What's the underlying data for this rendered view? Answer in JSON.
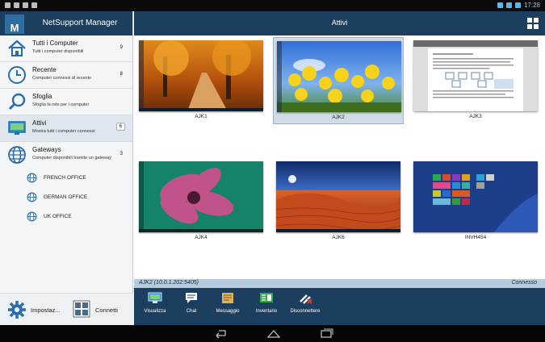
{
  "statusbar": {
    "clock": "17:28"
  },
  "sidebar": {
    "app_title": "NetSupport Manager",
    "logo_letter": "M",
    "items": [
      {
        "label": "Tutti i Computer",
        "sub": "Tutti i computer disponibili",
        "count": "9",
        "icon": "home-icon"
      },
      {
        "label": "Recente",
        "sub": "Computer connessi di recente",
        "count": "8",
        "icon": "clock-icon"
      },
      {
        "label": "Sfoglia",
        "sub": "Sfoglia la rete per i computer",
        "count": "",
        "icon": "search-icon"
      },
      {
        "label": "Attivi",
        "sub": "Mostra tutti i computer connessi",
        "count": "6",
        "icon": "monitor-icon"
      },
      {
        "label": "Gateways",
        "sub": "Computer disponibili tramite un gateway",
        "count": "3",
        "icon": "globe-icon"
      }
    ],
    "gateways": [
      {
        "label": "FRENCH OFFICE"
      },
      {
        "label": "GERMAN OFFICE"
      },
      {
        "label": "UK OFFICE"
      }
    ],
    "footer": {
      "settings_label": "Impostaz...",
      "connect_label": "Connetti"
    }
  },
  "main": {
    "title": "Attivi",
    "tiles": [
      {
        "name": "AJK1",
        "selected": false
      },
      {
        "name": "AJK2",
        "selected": true
      },
      {
        "name": "AJK3",
        "selected": false
      },
      {
        "name": "AJK4",
        "selected": false
      },
      {
        "name": "AJK6",
        "selected": false
      },
      {
        "name": "INVH454",
        "selected": false
      }
    ],
    "status_left": "AJK2 (10.0.1.202:5405)",
    "status_right": "Connesso",
    "toolbar": [
      {
        "label": "Visualizza",
        "icon": "view-icon"
      },
      {
        "label": "Chat",
        "icon": "chat-icon"
      },
      {
        "label": "Messaggio",
        "icon": "message-icon"
      },
      {
        "label": "Inventario",
        "icon": "inventory-icon"
      },
      {
        "label": "Disconnettere",
        "icon": "disconnect-icon"
      }
    ]
  },
  "colors": {
    "header": "#1d3f5f",
    "selection": "#cfdbe6",
    "status_strip": "#b6cbdd"
  }
}
